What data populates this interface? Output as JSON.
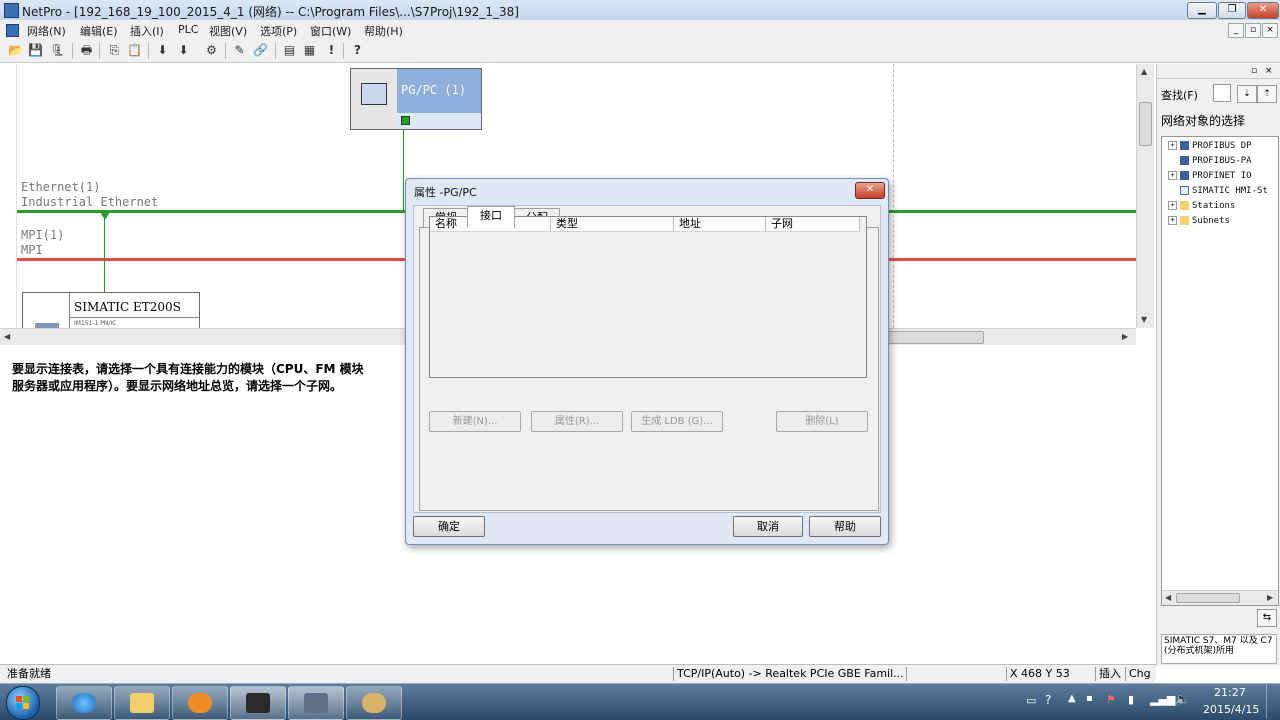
{
  "window": {
    "title": "NetPro - [192_168_19_100_2015_4_1 (网络) -- C:\\Program Files\\...\\S7Proj\\192_1_38]",
    "min": "▁",
    "max": "❐",
    "close": "✕"
  },
  "menu": {
    "items": [
      "网络(N)",
      "编辑(E)",
      "插入(I)",
      "PLC",
      "视图(V)",
      "选项(P)",
      "窗口(W)",
      "帮助(H)"
    ],
    "mdi": [
      "_",
      "▫",
      "×"
    ]
  },
  "toolbar": {
    "icons": [
      "open-icon",
      "save-icon",
      "save-compile-icon",
      "print-icon",
      "copy-icon",
      "paste-icon",
      "download-icon",
      "download-all-icon",
      "configure-icon",
      "edit-icon",
      "link-icon",
      "stations-icon",
      "open-hw-icon",
      "exclamation-icon",
      "help-pointer-icon"
    ],
    "glyphs": [
      "📂",
      "💾",
      "🗜",
      "🖶",
      "⎘",
      "📋",
      "⬇",
      "⬇",
      "⚙",
      "✎",
      "🔗",
      "▤",
      "▦",
      "!",
      "?"
    ]
  },
  "network": {
    "subnets": [
      {
        "name": "Ethernet(1)",
        "type": "Industrial Ethernet",
        "color": "#2c9a2c"
      },
      {
        "name": "MPI(1)",
        "type": "MPI",
        "color": "#e0504a"
      }
    ],
    "devices": {
      "pgpc": {
        "label": "PG/PC (1)"
      },
      "et200": {
        "label": "SIMATIC ET200S",
        "sub": "IM151-1 PN/IC"
      }
    }
  },
  "message": {
    "line1": "要显示连接表，请选择一个具有连接能力的模块（CPU、FM 模块",
    "line2": "服务器或应用程序）。要显示网络地址总览，请选择一个子网。"
  },
  "catalog": {
    "find_label": "查找(F)",
    "find_value": "",
    "section_title": "网络对象的选择",
    "tree": [
      {
        "label": "PROFIBUS DP",
        "expandable": true
      },
      {
        "label": "PROFIBUS-PA",
        "expandable": false
      },
      {
        "label": "PROFINET IO",
        "expandable": true
      },
      {
        "label": "SIMATIC HMI-St",
        "expandable": false
      },
      {
        "label": "Stations",
        "expandable": true
      },
      {
        "label": "Subnets",
        "expandable": true
      }
    ],
    "description": "SIMATIC S7、M7 以及 C7 (分布式机架)所用"
  },
  "status": {
    "ready": "准备就绪",
    "interface": "TCP/IP(Auto) -> Realtek PCIe GBE Famil...",
    "coords": "X 468   Y 53",
    "insert": "插入",
    "chg": "Chg"
  },
  "dialog": {
    "title": "属性 -PG/PC",
    "close": "✕",
    "tabs": [
      "常规",
      "接口",
      "分配"
    ],
    "selected_tab": "接口",
    "columns": [
      "名称",
      "类型",
      "地址",
      "子网"
    ],
    "buttons_disabled": [
      "新建(N)...",
      "属性(R)...",
      "生成 LDB (G)...",
      "删除(L)"
    ],
    "ok": "确定",
    "cancel": "取消",
    "help": "帮助"
  },
  "taskbar": {
    "apps": [
      "ie-icon",
      "explorer-icon",
      "media-icon",
      "simatic-icon",
      "netpro-icon",
      "paint-icon"
    ],
    "time": "21:27",
    "date": "2015/4/15"
  }
}
